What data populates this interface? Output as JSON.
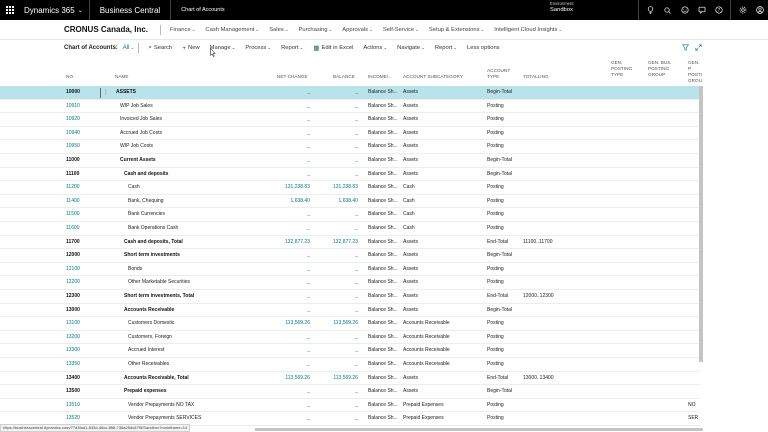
{
  "topbar": {
    "app": "Dynamics 365",
    "product": "Business Central",
    "page": "Chart of Accounts",
    "env_label": "Environment",
    "env_value": "Sandbox"
  },
  "nav": {
    "company": "CRONUS Canada, Inc.",
    "items": [
      {
        "label": "Finance",
        "dd": "⌄"
      },
      {
        "label": "Cash Management",
        "dd": "⌄"
      },
      {
        "label": "Sales",
        "dd": "⌄"
      },
      {
        "label": "Purchasing",
        "dd": "⌄"
      },
      {
        "label": "Approvals",
        "dd": "⌄"
      },
      {
        "label": "Self-Service",
        "dd": "⌄"
      },
      {
        "label": "Setup & Extensions",
        "dd": "⌄"
      },
      {
        "label": "Intelligent Cloud Insights",
        "dd": "⌄"
      }
    ]
  },
  "actions": {
    "title": "Chart of Accounts:",
    "filter": "All",
    "search": "Search",
    "new": "New",
    "manage": "Manage",
    "process": "Process",
    "report": "Report",
    "edit_excel": "Edit in Excel",
    "actions": "Actions",
    "navigate": "Navigate",
    "report2": "Report",
    "less": "Less options"
  },
  "columns": {
    "no": "No.",
    "name": "Name",
    "net_change": "Net Change",
    "balance": "Balance",
    "income": "Income/...",
    "subcat": "Account Subcategory",
    "acct_type_1": "Account",
    "acct_type_2": "Type",
    "totaling": "Totalling",
    "gen_post_1": "Gen.",
    "gen_post_2": "Posting",
    "gen_post_3": "Type",
    "gen_bus_1": "Gen. Bus.",
    "gen_bus_2": "Posting",
    "gen_bus_3": "Group",
    "gen_prod_1": "Gen. P",
    "gen_prod_2": "Posti",
    "gen_prod_3": "Group"
  },
  "rows": [
    {
      "no": "10000",
      "name": "ASSETS",
      "net": "_",
      "bal": "_",
      "inc": "Balance Sh...",
      "sub": "Assets",
      "type": "Begin-Total",
      "tot": "",
      "prod": "",
      "bold": true,
      "indent": 0,
      "selected": true
    },
    {
      "no": "10910",
      "name": "WIP Job Sales",
      "net": "_",
      "bal": "_",
      "inc": "Balance Sh...",
      "sub": "Assets",
      "type": "Posting",
      "tot": "",
      "prod": "",
      "bold": false,
      "indent": 1
    },
    {
      "no": "10920",
      "name": "Invoiced Job Sales",
      "net": "_",
      "bal": "_",
      "inc": "Balance Sh...",
      "sub": "Assets",
      "type": "Posting",
      "tot": "",
      "prod": "",
      "bold": false,
      "indent": 1
    },
    {
      "no": "10940",
      "name": "Accrued Job Costs",
      "net": "_",
      "bal": "_",
      "inc": "Balance Sh...",
      "sub": "Assets",
      "type": "Posting",
      "tot": "",
      "prod": "",
      "bold": false,
      "indent": 1
    },
    {
      "no": "10950",
      "name": "WIP Job Costs",
      "net": "_",
      "bal": "_",
      "inc": "Balance Sh...",
      "sub": "Assets",
      "type": "Posting",
      "tot": "",
      "prod": "",
      "bold": false,
      "indent": 1
    },
    {
      "no": "11000",
      "name": "Current Assets",
      "net": "_",
      "bal": "_",
      "inc": "Balance Sh...",
      "sub": "Assets",
      "type": "Begin-Total",
      "tot": "",
      "prod": "",
      "bold": true,
      "indent": 1
    },
    {
      "no": "11100",
      "name": "Cash and deposits",
      "net": "_",
      "bal": "_",
      "inc": "Balance Sh...",
      "sub": "Assets",
      "type": "Begin-Total",
      "tot": "",
      "prod": "",
      "bold": true,
      "indent": 2
    },
    {
      "no": "11200",
      "name": "Cash",
      "net": "131,238.83",
      "bal": "131,238.83",
      "inc": "Balance Sh...",
      "sub": "Cash",
      "type": "Posting",
      "tot": "",
      "prod": "",
      "bold": false,
      "indent": 3
    },
    {
      "no": "11400",
      "name": "Bank, Chequing",
      "net": "1,638.40",
      "bal": "1,638.40",
      "inc": "Balance Sh...",
      "sub": "Cash",
      "type": "Posting",
      "tot": "",
      "prod": "",
      "bold": false,
      "indent": 3
    },
    {
      "no": "11500",
      "name": "Bank Currencies",
      "net": "_",
      "bal": "_",
      "inc": "Balance Sh...",
      "sub": "Cash",
      "type": "Posting",
      "tot": "",
      "prod": "",
      "bold": false,
      "indent": 3
    },
    {
      "no": "11600",
      "name": "Bank Operations Cash",
      "net": "_",
      "bal": "_",
      "inc": "Balance Sh...",
      "sub": "Cash",
      "type": "Posting",
      "tot": "",
      "prod": "",
      "bold": false,
      "indent": 3
    },
    {
      "no": "11700",
      "name": "Cash and deposits, Total",
      "net": "132,877.23",
      "bal": "132,877.23",
      "inc": "Balance Sh...",
      "sub": "Assets",
      "type": "End-Total",
      "tot": "11100..11700",
      "prod": "",
      "bold": true,
      "indent": 2
    },
    {
      "no": "12000",
      "name": "Short term investments",
      "net": "_",
      "bal": "_",
      "inc": "Balance Sh...",
      "sub": "Assets",
      "type": "Begin-Total",
      "tot": "",
      "prod": "",
      "bold": true,
      "indent": 2
    },
    {
      "no": "12100",
      "name": "Bonds",
      "net": "_",
      "bal": "_",
      "inc": "Balance Sh...",
      "sub": "Assets",
      "type": "Posting",
      "tot": "",
      "prod": "",
      "bold": false,
      "indent": 3
    },
    {
      "no": "12200",
      "name": "Other Marketable Securities",
      "net": "_",
      "bal": "_",
      "inc": "Balance Sh...",
      "sub": "Assets",
      "type": "Posting",
      "tot": "",
      "prod": "",
      "bold": false,
      "indent": 3
    },
    {
      "no": "12300",
      "name": "Short term investments, Total",
      "net": "_",
      "bal": "_",
      "inc": "Balance Sh...",
      "sub": "Assets",
      "type": "End-Total",
      "tot": "12000..12300",
      "prod": "",
      "bold": true,
      "indent": 2
    },
    {
      "no": "13000",
      "name": "Accounts Receivable",
      "net": "_",
      "bal": "_",
      "inc": "Balance Sh...",
      "sub": "Assets",
      "type": "Begin-Total",
      "tot": "",
      "prod": "",
      "bold": true,
      "indent": 2
    },
    {
      "no": "13100",
      "name": "Customers Domestic",
      "net": "113,569.26",
      "bal": "113,569.26",
      "inc": "Balance Sh...",
      "sub": "Accounts Receivable",
      "type": "Posting",
      "tot": "",
      "prod": "",
      "bold": false,
      "indent": 3
    },
    {
      "no": "13200",
      "name": "Customers, Foreign",
      "net": "_",
      "bal": "_",
      "inc": "Balance Sh...",
      "sub": "Accounts Receivable",
      "type": "Posting",
      "tot": "",
      "prod": "",
      "bold": false,
      "indent": 3
    },
    {
      "no": "13300",
      "name": "Accrued Interest",
      "net": "_",
      "bal": "_",
      "inc": "Balance Sh...",
      "sub": "Accounts Receivable",
      "type": "Posting",
      "tot": "",
      "prod": "",
      "bold": false,
      "indent": 3
    },
    {
      "no": "13350",
      "name": "Other Receivables",
      "net": "_",
      "bal": "_",
      "inc": "Balance Sh...",
      "sub": "Accounts Receivable",
      "type": "Posting",
      "tot": "",
      "prod": "",
      "bold": false,
      "indent": 3
    },
    {
      "no": "13400",
      "name": "Accounts Receivable, Total",
      "net": "113,569.26",
      "bal": "113,569.26",
      "inc": "Balance Sh...",
      "sub": "Assets",
      "type": "End-Total",
      "tot": "13000..13400",
      "prod": "",
      "bold": true,
      "indent": 2
    },
    {
      "no": "13500",
      "name": "Prepaid expenses",
      "net": "_",
      "bal": "_",
      "inc": "Balance Sh...",
      "sub": "Assets",
      "type": "Begin-Total",
      "tot": "",
      "prod": "",
      "bold": true,
      "indent": 2
    },
    {
      "no": "13510",
      "name": "Vendor Prepayments NO TAX",
      "net": "_",
      "bal": "_",
      "inc": "Balance Sh...",
      "sub": "Prepaid Expenses",
      "type": "Posting",
      "tot": "",
      "prod": "NO",
      "bold": false,
      "indent": 3
    },
    {
      "no": "13520",
      "name": "Vendor Prepayments SERVICES",
      "net": "_",
      "bal": "_",
      "inc": "Balance Sh...",
      "sub": "Prepaid Expenses",
      "type": "Posting",
      "tot": "",
      "prod": "SER",
      "bold": false,
      "indent": 3
    }
  ],
  "status_url": "https://businesscentral.dynamics.com/77d3fad1-833d-46cc-8f6f-736a25dd47f5/Sandbox?runinframe=14"
}
